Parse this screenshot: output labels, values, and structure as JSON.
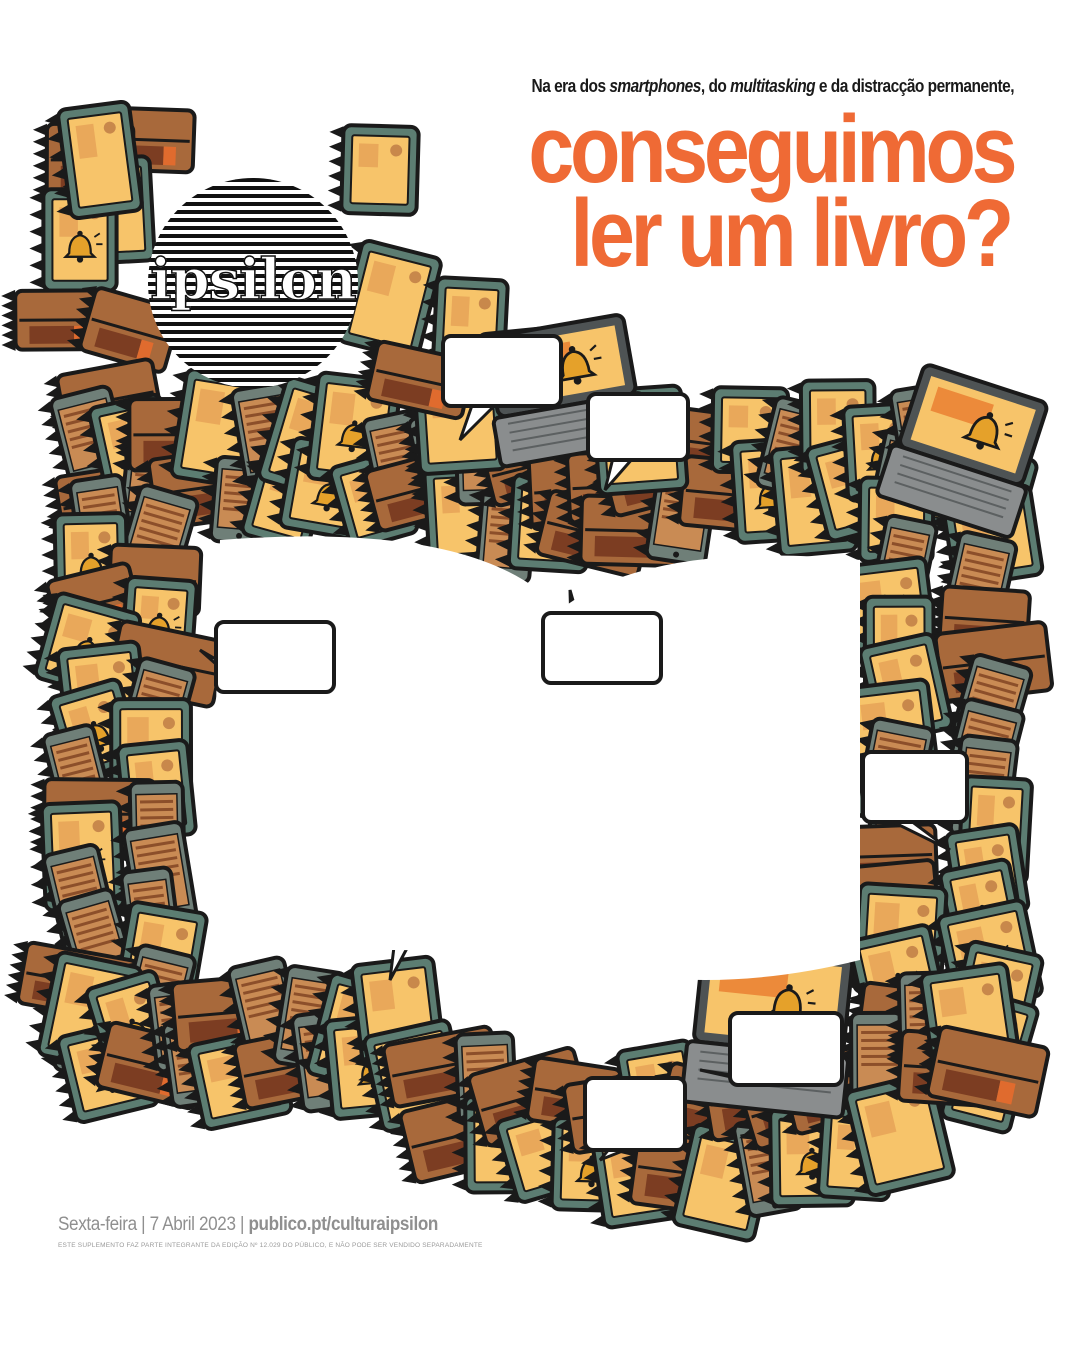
{
  "cover": {
    "kicker": {
      "part1": "Na era dos ",
      "part2": "smartphones",
      "part3": ", do ",
      "part4": "multitasking",
      "part5": " e da distracção permanente,"
    },
    "headline": {
      "line1": "conseguimos",
      "line2": "ler um livro?"
    },
    "logo_text": "ipsilon",
    "footer": {
      "date": "Sexta-feira | 7 Abril 2023 |",
      "url": "publico.pt/culturaipsilon",
      "disclaimer": "ESTE SUPLEMENTO FAZ PARTE INTEGRANTE DA EDIÇÃO Nº 12.029 DO PÚBLICO, E NÃO PODE SER VENDIDO SEPARADAMENTE"
    }
  },
  "colors": {
    "headline_orange": "#ef6a35",
    "device_green": "#5c7d72",
    "device_brown": "#a8693b",
    "screen_yellow": "#f7c46a",
    "laptop_grey": "#8a8d8e",
    "outline": "#1a1a1a",
    "footer_grey": "#8f8f8f"
  },
  "icons": [
    "tablet-icon",
    "phone-icon",
    "laptop-icon",
    "notebook-icon",
    "bell-notification-icon",
    "speech-bubble-icon"
  ]
}
